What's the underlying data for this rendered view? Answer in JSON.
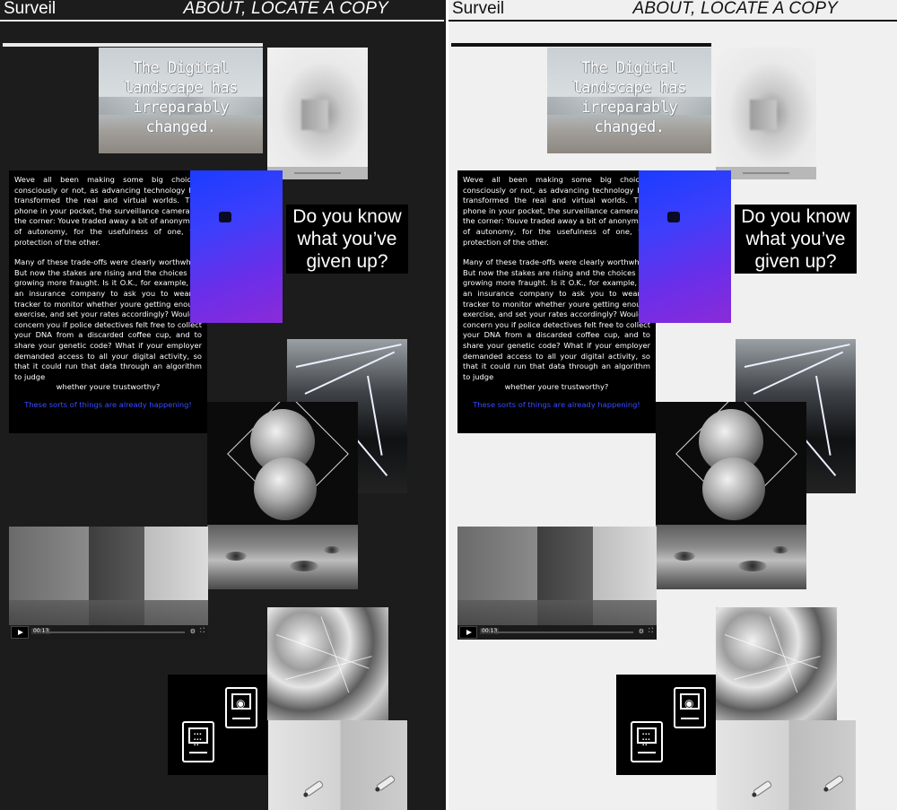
{
  "site": {
    "brand": "Surveil",
    "nav": "ABOUT, LOCATE A COPY"
  },
  "landscape_tile": {
    "text_lines": [
      "The Digital",
      "landscape has",
      "irreparably",
      "changed."
    ]
  },
  "article": {
    "paragraph1": "Weve all been making some big choices, consciously or not, as advancing technology has transformed the real and virtual worlds. That phone in your pocket, the surveillance camera on the corner: Youve traded away a bit of anonymity, of autonomy, for the usefulness of one, the protection of the other.",
    "paragraph2": "Many of these trade-offs were clearly worthwhile. But now the stakes are rising and the choices are growing more fraught. Is it O.K., for example, for an insurance company to ask you to wear a tracker to monitor whether youre getting enough exercise, and set your rates accordingly? Would it concern you if police detectives felt free to collect your DNA from a discarded coffee cup, and to share your genetic code? What if your employer demanded access to all your digital activity, so that it could run that data through an algorithm to judge",
    "paragraph2_end": "whether youre trustworthy?",
    "highlight": "These sorts of things are already happening!"
  },
  "question": {
    "lines": [
      "Do you know",
      "what you’ve",
      "given up?"
    ]
  },
  "video_player": {
    "time": "00:13"
  },
  "icons": {
    "eye": "eye-icon",
    "computer": "computer-icon",
    "play": "play-icon",
    "settings": "gear-icon",
    "fullscreen": "fullscreen-icon"
  },
  "colors": {
    "dark_bg": "#1c1c1c",
    "light_bg": "#f0f0f0",
    "highlight_blue": "#3a4dff"
  }
}
